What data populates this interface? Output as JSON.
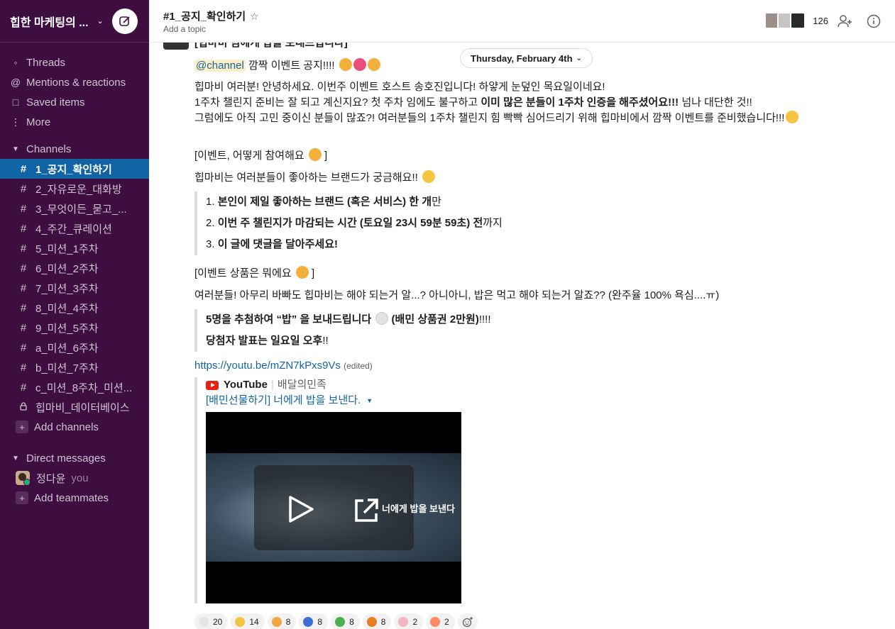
{
  "workspace": {
    "name": "힙한 마케팅의 ..."
  },
  "nav": [
    {
      "label": "Threads",
      "icon": "threads-icon"
    },
    {
      "label": "Mentions & reactions",
      "icon": "at-icon"
    },
    {
      "label": "Saved items",
      "icon": "bookmark-icon"
    },
    {
      "label": "More",
      "icon": "more-icon"
    }
  ],
  "channels_header": "Channels",
  "channels": [
    "1_공지_확인하기",
    "2_자유로운_대화방",
    "3_무엇이든_묻고_...",
    "4_주간_큐레이션",
    "5_미션_1주차",
    "6_미션_2주차",
    "7_미션_3주차",
    "8_미션_4주차",
    "9_미션_5주차",
    "a_미션_6주차",
    "b_미션_7주차",
    "c_미션_8주차_미션...",
    "힙마비_데이터베이스"
  ],
  "add_channels": "Add channels",
  "dm_header": "Direct messages",
  "dm_user": {
    "name": "정다윤",
    "you": "you"
  },
  "add_teammates": "Add teammates",
  "header": {
    "channel_title": "#1_공지_확인하기",
    "topic": "Add a topic",
    "member_count": "126"
  },
  "date_pill": "Thursday, February 4th",
  "message": {
    "cut_line": "[힙마비 팀에게 밥을 보내드립니다]",
    "mention": "@channel",
    "headline": " 깜짝 이벤트 공지!!!!",
    "p1": "힙마비 여러분! 안녕하세요. 이번주 이벤트 호스트 송호진입니다!  하얗게 눈덮인 목요일이네요!",
    "p2a": "1주차 챌린지 준비는 잘 되고 계신지요? 첫 주차 임에도 불구하고 ",
    "p2b": "이미 많은 분들이 1주차 인증을 해주셨어요!!!",
    "p2c": " 넘나 대단한 것!!",
    "p3": "그럼에도 아직 고민 중이신 분들이 많죠?! 여러분들의 1주차 챌린지 힘 빡빡 심어드리기 위해 힙마비에서 깜짝 이벤트를 준비했습니다!!!",
    "h1": "[이벤트, 어떻게 참여해요",
    "h1_end": " ]",
    "p4": "힙마비는 여러분들이 좋아하는 브랜드가 궁금해요!!",
    "q1_num": "1.  ",
    "q1_bold": "본인이 제일 좋아하는 브랜드 (혹은 서비스) 한 개",
    "q1_end": "만",
    "q2_num": "2. ",
    "q2_bold": "이번 주 챌린지가 마감되는 시간 (토요일 23시 59분 59초) 전",
    "q2_end": "까지",
    "q3_num": "3. ",
    "q3_bold": "이 글에 댓글을 달아주세요!",
    "h2": "[이벤트 상품은 뭐에요",
    "h2_end": " ]",
    "p5": "여러분들! 아무리 바빠도 힙마비는 해야 되는거 알...? 아니아니, 밥은 먹고 해야 되는거 알죠?? (완주율 100% 욕심....ㅠ)",
    "r1a": "5명을 추첨하여  “밥” 을 보내드립니다",
    "r1b": " (배민 상품권 2만원)",
    "r1c": "!!!!",
    "r2a": "당첨자 발표는  일요일 오후",
    "r2b": "!!",
    "link": "https://youtu.be/mZN7kPxs9Vs",
    "edited": "(edited)"
  },
  "unfurl": {
    "service": "YouTube",
    "author": "배달의민족",
    "title": "[배민선물하기] 너에게 밥을 보낸다.",
    "video_caption": "너에게 밥을 보낸다"
  },
  "reactions": [
    {
      "count": "20",
      "color": "#e6e6e6"
    },
    {
      "count": "14",
      "color": "#f4c542"
    },
    {
      "count": "8",
      "color": "#f0a640"
    },
    {
      "count": "8",
      "color": "#3b6fd1"
    },
    {
      "count": "8",
      "color": "#4caf50"
    },
    {
      "count": "8",
      "color": "#e67e22"
    },
    {
      "count": "2",
      "color": "#f7b3c2"
    },
    {
      "count": "2",
      "color": "#ff8a65"
    }
  ]
}
